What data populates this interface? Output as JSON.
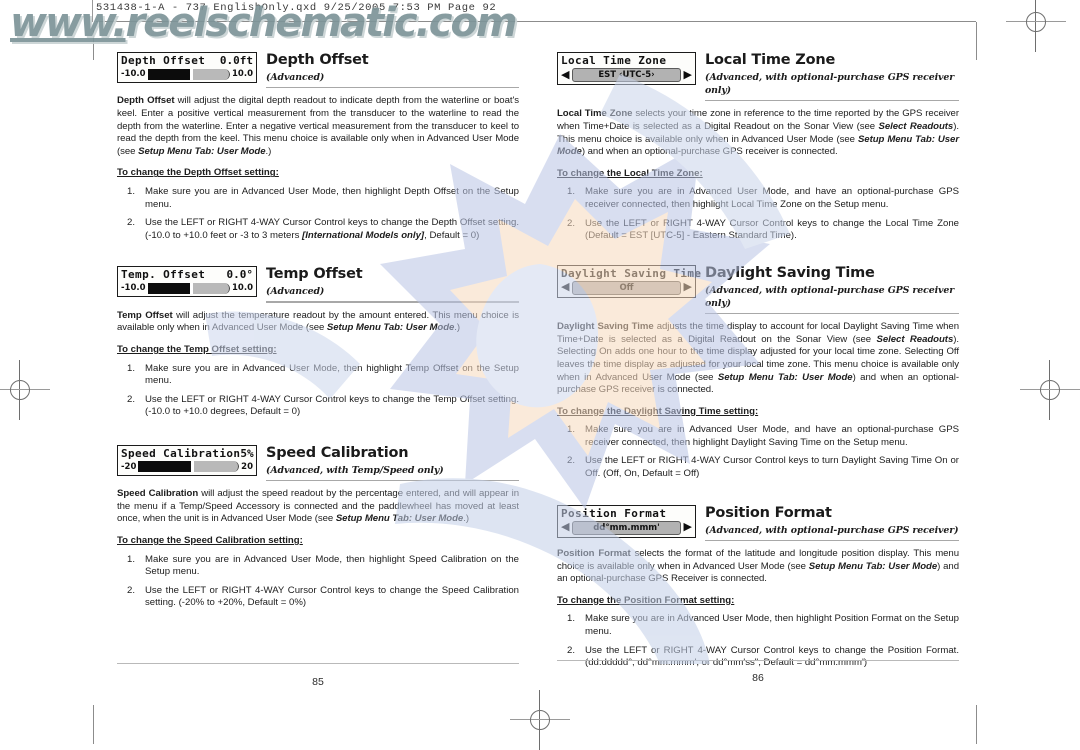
{
  "print_slug": "531438-1-A - 737 EnglishOnly.qxd   9/25/2005   7:53 PM   Page 92",
  "watermark": {
    "text": "www.reelschematic.com"
  },
  "left_page": {
    "number": "85",
    "sections": [
      {
        "lcd": {
          "kind": "slider",
          "title_label": "Depth Offset",
          "title_value": "0.0ft",
          "min_label": "-10.0",
          "max_label": "10.0",
          "fill_percent": 50
        },
        "title": "Depth Offset",
        "subtitle": "(Advanced)",
        "body": "Depth Offset will adjust the digital depth readout to indicate depth from the waterline or boat's keel. Enter a positive vertical measurement from the transducer to the waterline to read the depth from the waterline. Enter a negative vertical measurement from the transducer to keel to read the depth from the keel. This menu choice is available only when in Advanced User Mode (see Setup Menu Tab: User Mode.)",
        "howto": "To change the Depth Offset setting:",
        "steps": [
          "Make sure you are in Advanced User Mode, then highlight Depth Offset on the Setup menu.",
          "Use the LEFT or RIGHT 4-WAY Cursor Control keys to change the Depth Offset setting. (-10.0 to +10.0 feet or -3 to 3 meters [International Models only], Default = 0)"
        ]
      },
      {
        "lcd": {
          "kind": "slider",
          "title_label": "Temp. Offset",
          "title_value": "0.0°",
          "min_label": "-10.0",
          "max_label": "10.0",
          "fill_percent": 50
        },
        "title": "Temp Offset",
        "subtitle": "(Advanced)",
        "body": "Temp Offset will adjust the temperature readout by the amount entered. This menu choice is available only when in Advanced User Mode  (see Setup Menu Tab: User Mode.)",
        "howto": "To change the Temp Offset setting:",
        "steps": [
          "Make sure you are in Advanced User Mode, then highlight Temp Offset on the Setup menu.",
          "Use the LEFT or RIGHT 4-WAY Cursor Control keys to change the Temp Offset setting. (-10.0 to +10.0 degrees, Default = 0)"
        ]
      },
      {
        "lcd": {
          "kind": "slider",
          "title_label": "Speed Calibration",
          "title_value": "5%",
          "min_label": "-20",
          "max_label": "20",
          "fill_percent": 50
        },
        "title": "Speed Calibration",
        "subtitle": "(Advanced, with Temp/Speed only)",
        "body": "Speed Calibration will adjust the speed readout by the percentage entered, and will appear in the menu if a Temp/Speed Accessory is connected and the paddlewheel has moved at least once, when the unit is in Advanced User Mode (see Setup Menu Tab: User Mode.)",
        "howto": "To change the Speed Calibration setting:",
        "steps": [
          "Make sure you are in Advanced User Mode, then highlight Speed Calibration on the Setup menu.",
          "Use the LEFT or RIGHT 4-WAY Cursor Control keys to change the Speed Calibration setting. (-20% to +20%, Default = 0%)"
        ]
      }
    ]
  },
  "right_page": {
    "number": "86",
    "sections": [
      {
        "lcd": {
          "kind": "select",
          "title_label": "Local Time Zone",
          "value": "EST ‹UTC-5›",
          "left_arrow": "◀",
          "right_arrow": "▶"
        },
        "title": "Local Time Zone",
        "subtitle": "(Advanced, with optional-purchase GPS receiver only)",
        "body": "Local Time Zone selects your time zone in reference to the time reported by the GPS receiver when Time+Date is selected as a Digital Readout on the Sonar View (see Select Readouts).  This menu choice is available only when in Advanced User Mode (see Setup Menu Tab: User Mode) and when an optional-purchase GPS receiver is connected.",
        "howto": "To change the Local Time Zone:",
        "steps": [
          "Make sure you are in Advanced User Mode, and have an optional-purchase GPS receiver connected, then highlight Local Time Zone on the Setup menu.",
          "Use the LEFT or RIGHT 4-WAY Cursor Control keys to change the Local Time Zone (Default = EST [UTC-5] - Eastern Standard Time)."
        ]
      },
      {
        "lcd": {
          "kind": "select",
          "title_label": "Daylight Saving Time",
          "value": "Off",
          "left_arrow": "◀",
          "right_arrow": "▶"
        },
        "title": "Daylight Saving Time",
        "subtitle": "(Advanced, with optional-purchase GPS receiver only)",
        "body": "Daylight Saving Time adjusts the time display to account for local Daylight Saving Time when Time+Date is selected as a Digital Readout on the Sonar View (see Select Readouts). Selecting On adds one hour to the time display adjusted for your local time zone.  Selecting Off leaves the time display as adjusted for your local time zone. This menu choice is available only when in Advanced User Mode (see Setup Menu Tab: User Mode) and when an optional-purchase GPS receiver is connected.",
        "howto": "To change the Daylight Saving Time setting:",
        "steps": [
          "Make sure you are in Advanced User Mode, and have an optional-purchase GPS receiver connected, then highlight Daylight Saving Time on the Setup menu.",
          "Use the LEFT or RIGHT 4-WAY Cursor Control keys to turn Daylight Saving Time On or Off. (Off, On, Default = Off)"
        ]
      },
      {
        "lcd": {
          "kind": "select",
          "title_label": "Position Format",
          "value": "dd°mm.mmm'",
          "left_arrow": "◀",
          "right_arrow": "▶"
        },
        "title": "Position Format",
        "subtitle": "(Advanced, with optional-purchase GPS receiver)",
        "body": "Position Format selects the format of the latitude and longitude position display.   This menu choice is available only when in Advanced User Mode (see Setup Menu Tab: User Mode) and an optional-purchase GPS Receiver is connected.",
        "howto": "To change the Position Format setting:",
        "steps": [
          "Make sure you are in Advanced User Mode, then highlight Position Format on the Setup menu.",
          "Use the LEFT or RIGHT 4-WAY Cursor Control keys to change the Position Format. (dd.ddddd°, dd°mm.mmm', or dd°mm'ss\", Default = dd°mm.mmm')"
        ]
      }
    ]
  }
}
